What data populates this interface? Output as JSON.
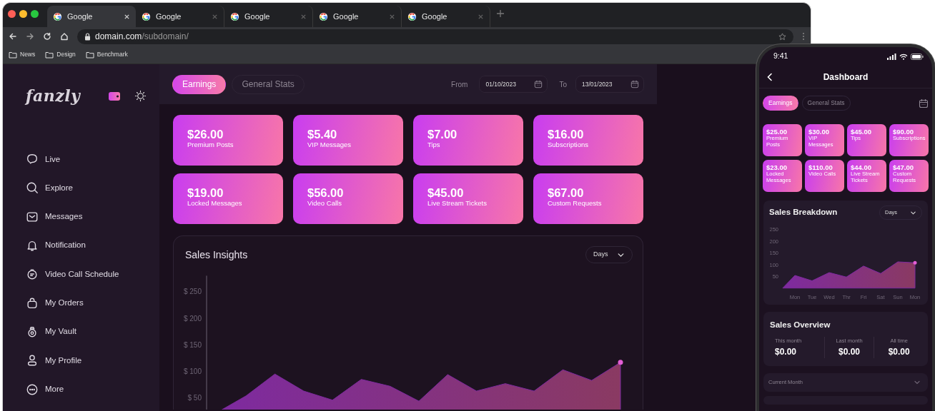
{
  "browser": {
    "tabs": [
      {
        "title": "Google",
        "selected": true
      },
      {
        "title": "Google",
        "selected": false
      },
      {
        "title": "Google",
        "selected": false
      },
      {
        "title": "Google",
        "selected": false
      },
      {
        "title": "Google",
        "selected": false
      }
    ],
    "url": {
      "host": "domain.com",
      "path": "/subdomain/"
    },
    "bookmarks": [
      "News",
      "Design",
      "Benchmark"
    ]
  },
  "dashboard": {
    "logo": "fanzly",
    "nav": [
      "Live",
      "Explore",
      "Messages",
      "Notification",
      "Video Call Schedule",
      "My Orders",
      "My Vault",
      "My Profile",
      "More"
    ],
    "tabs": [
      {
        "label": "Earnings",
        "selected": true
      },
      {
        "label": "General Stats",
        "selected": false
      }
    ],
    "from": {
      "label": "From",
      "value": "01/10/2023"
    },
    "to": {
      "label": "To",
      "value": "13/01/2023"
    },
    "cards": [
      {
        "amount": "$26.00",
        "label": "Premium Posts"
      },
      {
        "amount": "$5.40",
        "label": "VIP Messages"
      },
      {
        "amount": "$7.00",
        "label": "Tips"
      },
      {
        "amount": "$16.00",
        "label": "Subscriptions"
      },
      {
        "amount": "$19.00",
        "label": "Locked Messages"
      },
      {
        "amount": "$56.00",
        "label": "Video Calls"
      },
      {
        "amount": "$45.00",
        "label": "Live Stream Tickets"
      },
      {
        "amount": "$67.00",
        "label": "Custom Requests"
      }
    ],
    "sales_insights": {
      "title": "Sales Insights",
      "period": "Days",
      "chart_data": {
        "type": "area",
        "ylim": [
          0,
          280
        ],
        "yticks": [
          {
            "value": 50,
            "label": "$ 50"
          },
          {
            "value": 100,
            "label": "$ 100"
          },
          {
            "value": 150,
            "label": "$ 150"
          },
          {
            "value": 200,
            "label": "$ 200"
          },
          {
            "value": 250,
            "label": "$ 250"
          }
        ],
        "series": [
          {
            "color": "#7e2aa0",
            "values": [
              23,
              54,
              95,
              63,
              46,
              85,
              72,
              44,
              94,
              63,
              77,
              63,
              103,
              83,
              117
            ]
          }
        ]
      }
    }
  },
  "phone": {
    "time": "9:41",
    "title": "Dashboard",
    "tabs": [
      {
        "label": "Earnings",
        "selected": true
      },
      {
        "label": "General Stats",
        "selected": false
      }
    ],
    "cards": [
      {
        "amount": "$25.00",
        "label": "Premium Posts"
      },
      {
        "amount": "$30.00",
        "label": "VIP Messages"
      },
      {
        "amount": "$45.00",
        "label": "Tips"
      },
      {
        "amount": "$90.00",
        "label": "Subscriptions"
      },
      {
        "amount": "$23.00",
        "label": "Locked Messages"
      },
      {
        "amount": "$110.00",
        "label": "Video Calls"
      },
      {
        "amount": "$44.00",
        "label": "Live Stream Tickets"
      },
      {
        "amount": "$47.00",
        "label": "Custom Requests"
      }
    ],
    "sales_breakdown": {
      "title": "Sales Breakdown",
      "period": "Days",
      "chart_data": {
        "type": "area",
        "categories": [
          "Mon",
          "Tue",
          "Wed",
          "Thr",
          "Fri",
          "Sat",
          "Sun",
          "Mon"
        ],
        "ylim": [
          0,
          250
        ],
        "yticks": [
          50,
          100,
          150,
          200,
          250
        ],
        "series": [
          {
            "color": "#7e2aa0",
            "values": [
              54,
              31,
              66,
              47,
              94,
              62,
              112,
              108
            ]
          }
        ]
      }
    },
    "sales_overview": {
      "title": "Sales Overview",
      "stats": [
        {
          "label": "This month",
          "value": "$0.00"
        },
        {
          "label": "Last month",
          "value": "$0.00"
        },
        {
          "label": "All time",
          "value": "$0.00"
        }
      ]
    },
    "current_month": "Current Month"
  }
}
